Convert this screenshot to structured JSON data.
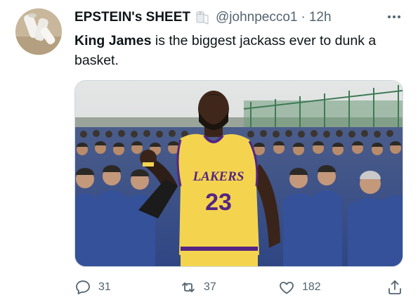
{
  "tweet": {
    "display_name": "EPSTEIN's SHEET",
    "name_emoji": "toilet-paper-roll",
    "handle": "@johnpecco1",
    "separator": "·",
    "timestamp": "12h",
    "text_bold": "King James",
    "text_rest": " is the biggest jackass ever to dunk a basket.",
    "media": {
      "jersey_team": "LAKERS",
      "jersey_number": "23"
    },
    "actions": {
      "replies": "31",
      "retweets": "37",
      "likes": "182"
    }
  },
  "icons": [
    "avatar",
    "toilet-paper-roll-icon",
    "more-icon",
    "reply-icon",
    "retweet-icon",
    "like-icon",
    "share-icon"
  ],
  "colors": {
    "text_primary": "#0f1419",
    "text_secondary": "#536471",
    "jersey_gold": "#f4d44f",
    "jersey_purple": "#552583",
    "uniform_blue": "#3f5a9a"
  }
}
